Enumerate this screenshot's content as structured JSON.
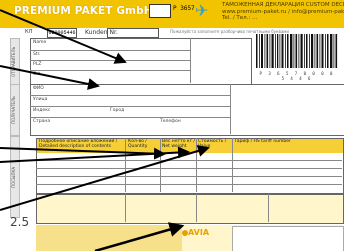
{
  "header": {
    "brand": "PREMIUM PAKET GmbH",
    "paket_no": "P 3657",
    "declaration_title": "ТАМОЖЕННАЯ ДЕКЛАРАЦИЯ CUSTOM DECLARATION",
    "declaration_line2": "www.premium-paket.ru / info@premium-paket.ru",
    "declaration_line3": "Tel. / Тел.: ..."
  },
  "topline": {
    "ru_label": "КЛ",
    "customer_number": "020005446",
    "kunden_label": "Kunden Nr.",
    "note": "Пожалуйста заполните разборчиво печатными буквами"
  },
  "barcode": {
    "digits": "P 3 6 5 7 0 0 0 0 5 4 4 6"
  },
  "sender": {
    "side_label": "ОТПРАВИТЕЛЬ",
    "labels": [
      "Name",
      "Str.",
      "PLZ",
      "Ort"
    ],
    "values": [
      "",
      "",
      "",
      ""
    ]
  },
  "recipient": {
    "side_label": "ПОЛУЧАТЕЛЬ",
    "labels": [
      "ФИО",
      "Улица",
      "Индекс",
      "Город",
      "Страна",
      "Телефон"
    ]
  },
  "goods": {
    "side_label": "ПОСЫЛКА",
    "headers": [
      "Подробное описание вложений / Detailed description of contents",
      "Кол-во / Quantity",
      "Вес нетто кг / Net weight",
      "Стоимость / Value",
      "Тариф / HS tariff number"
    ]
  },
  "footer": {
    "ruler_text": "2.5",
    "avia_label": "AVIA"
  },
  "colors": {
    "header_yellow": "#f2c300",
    "table_yellow": "#f5cf35",
    "cream": "#fff6cc",
    "arrow_black": "#000000"
  }
}
